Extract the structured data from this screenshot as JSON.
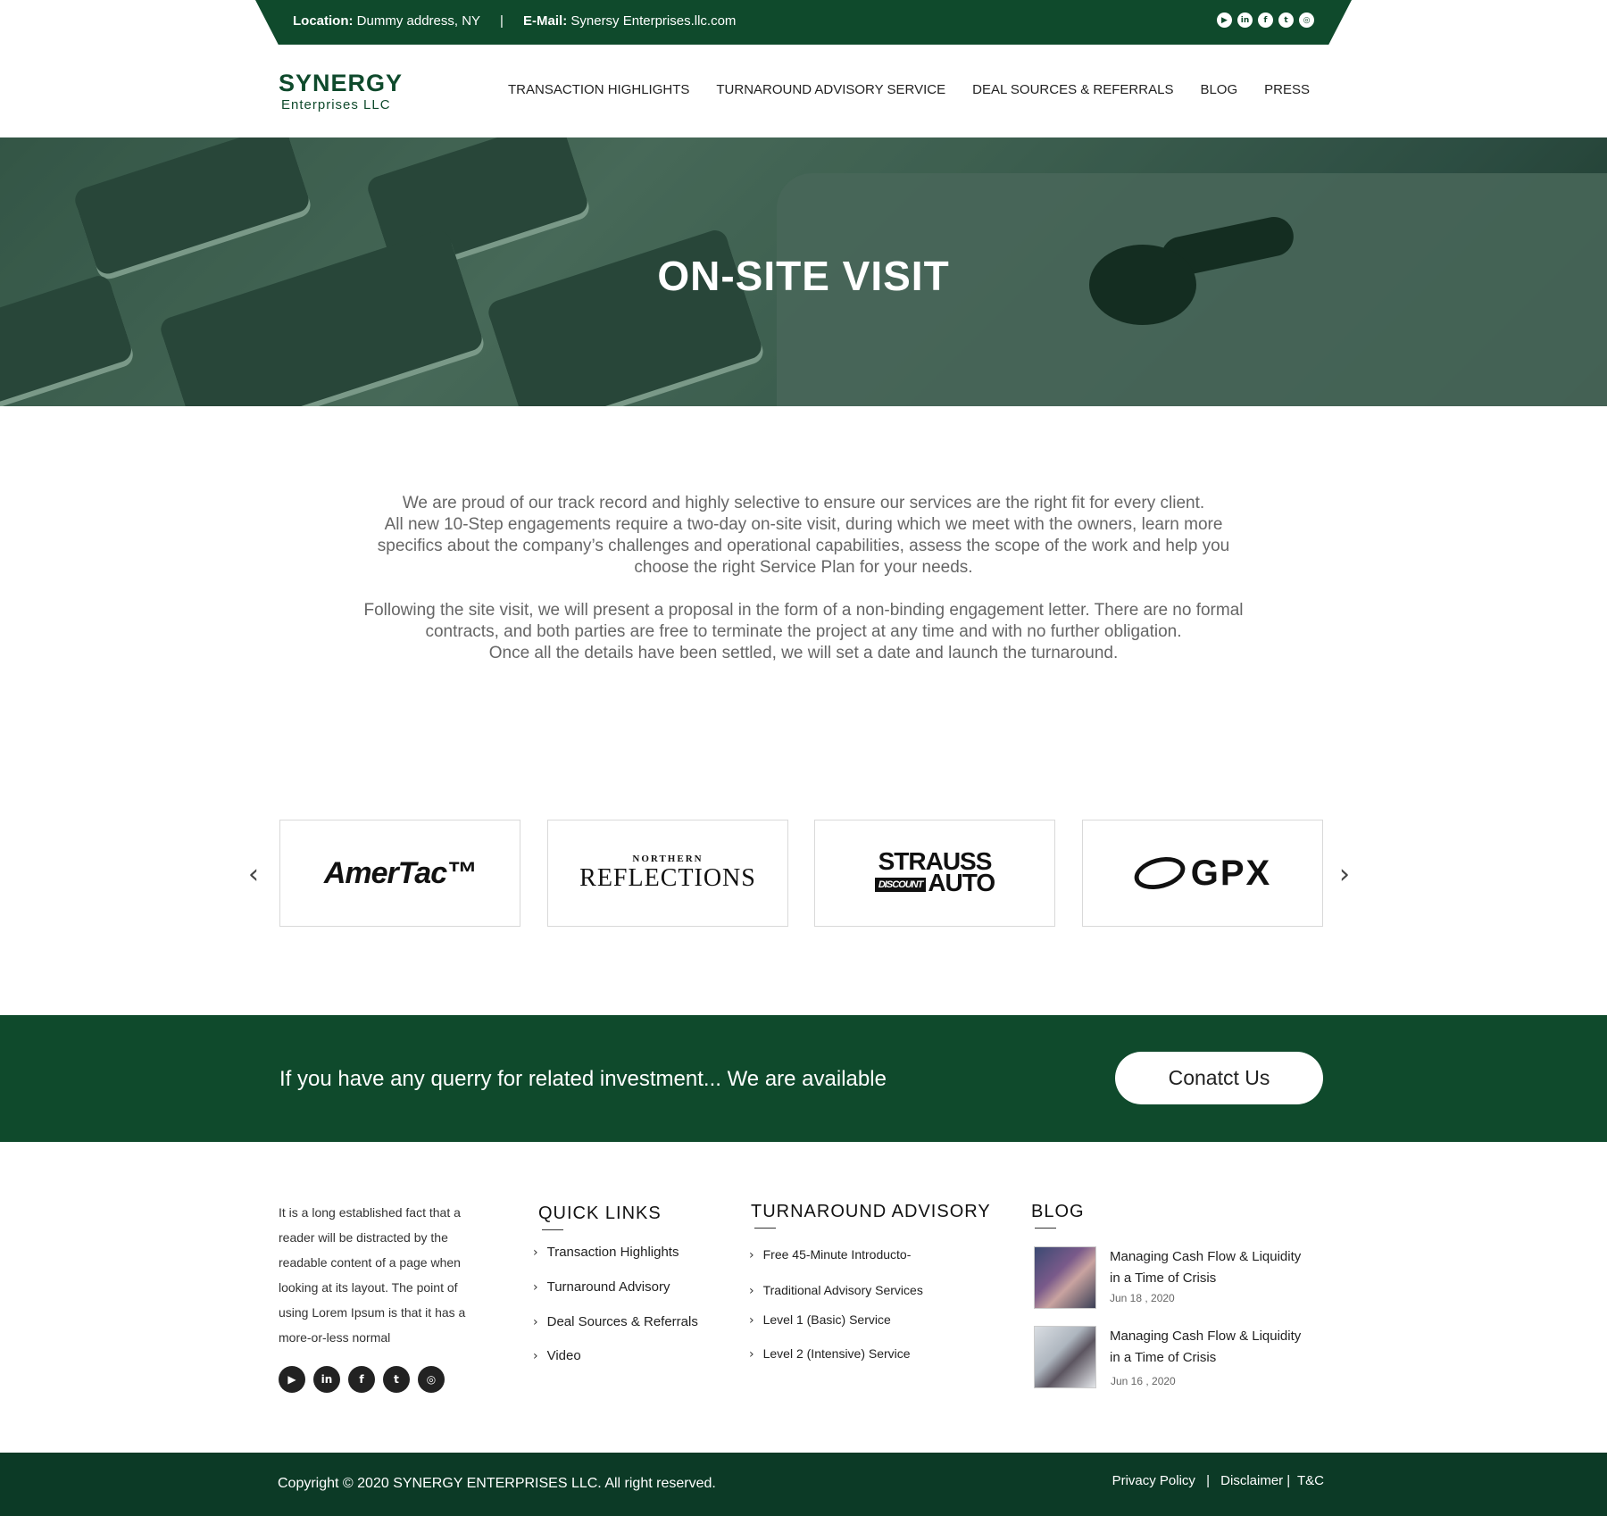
{
  "topbar": {
    "location_label": "Location:",
    "location_value": "Dummy address, NY",
    "separator": "|",
    "email_label": "E-Mail:",
    "email_value": "Synersy Enterprises.llc.com",
    "socials": [
      "youtube-icon",
      "linkedin-icon",
      "facebook-icon",
      "twitter-icon",
      "instagram-icon"
    ],
    "social_glyphs": [
      "▶",
      "in",
      "f",
      "t",
      "◎"
    ]
  },
  "header": {
    "logo_line1": "SYNERGY",
    "logo_line2": "Enterprises LLC",
    "nav": [
      "TRANSACTION HIGHLIGHTS",
      "TURNAROUND ADVISORY SERVICE",
      "DEAL SOURCES & REFERRALS",
      "BLOG",
      "PRESS"
    ]
  },
  "hero": {
    "title": "ON-SITE VISIT"
  },
  "content": {
    "p1": "We are proud of our track record and highly selective to ensure our services are the right fit for every client.",
    "p2": "All new 10-Step engagements require a two-day on-site visit, during which we meet with the owners, learn more specifics about the company’s challenges and operational capabilities, assess the scope of the work and help you choose the right Service Plan for your needs.",
    "p3": "Following the site visit, we will present a proposal in the form of a non-binding engagement letter. There are no formal contracts, and both parties are free to terminate the project at any time and with no further obligation.",
    "p4": "Once all the details have been settled, we will  set a date and launch the turnaround."
  },
  "clients": {
    "prev": "‹",
    "next": "›",
    "logos": {
      "amertac": "AmerTac™",
      "nr_small": "NORTHERN",
      "nr_big": "REFLECTIONS",
      "strauss_top": "STRAUSS",
      "strauss_discount": "DISCOUNT",
      "strauss_auto": "AUTO",
      "gpx": "GPX"
    }
  },
  "cta": {
    "text": "If you have any querry for related investment... We are available",
    "button": "Conatct Us"
  },
  "footer": {
    "about": "It is a long established fact that a reader will be distracted by the readable content of a page when looking at its layout. The point of using Lorem Ipsum is that it has a more-or-less normal",
    "social_glyphs": [
      "▶",
      "in",
      "f",
      "t",
      "◎"
    ],
    "quick_links_title": "QUICK LINKS",
    "quick_links": [
      "Transaction Highlights",
      "Turnaround Advisory",
      "Deal Sources & Referrals",
      "Video"
    ],
    "advisory_title": "TURNAROUND ADVISORY",
    "advisory_links": [
      "Free 45-Minute Introducto-",
      "Traditional Advisory Services",
      "Level 1 (Basic) Service",
      "Level 2 (Intensive) Service"
    ],
    "blog_title": "BLOG",
    "blog_posts": [
      {
        "title": "Managing Cash Flow & Liquidity in a Time of Crisis",
        "date": "Jun 18 , 2020"
      },
      {
        "title": "Managing Cash Flow & Liquidity in a Time of Crisis",
        "date": "Jun 16 , 2020"
      }
    ],
    "chevron": "›"
  },
  "bottom": {
    "copyright": "Copyright © 2020 SYNERGY ENTERPRISES LLC. All right reserved.",
    "privacy": "Privacy Policy",
    "sep1": "|",
    "disclaimer": "Disclaimer",
    "sep2": "|",
    "tc": "T&C"
  },
  "colors": {
    "brand_green": "#0f4a2c",
    "bottom_green": "#0c3a26"
  }
}
